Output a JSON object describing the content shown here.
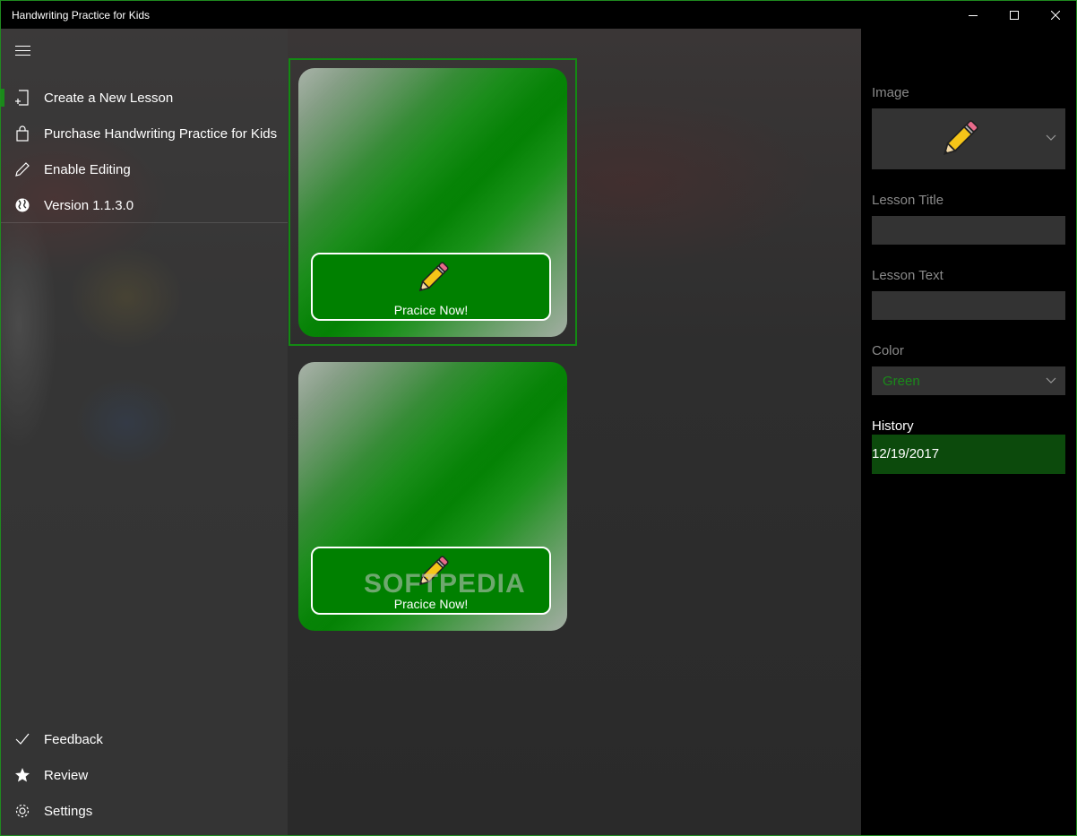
{
  "window": {
    "title": "Handwriting Practice for Kids"
  },
  "nav": {
    "items": [
      {
        "label": "Create a New Lesson",
        "icon": "new-lesson-icon"
      },
      {
        "label": "Purchase Handwriting Practice for Kids",
        "icon": "shopping-bag-icon"
      },
      {
        "label": "Enable Editing",
        "icon": "pencil-icon"
      },
      {
        "label": "Version 1.1.3.0",
        "icon": "globe-icon"
      }
    ],
    "footer": [
      {
        "label": "Feedback",
        "icon": "checkmark-icon"
      },
      {
        "label": "Review",
        "icon": "star-icon"
      },
      {
        "label": "Settings",
        "icon": "gear-icon"
      }
    ]
  },
  "tiles": [
    {
      "button_label": "Pracice Now!",
      "color": "#008000"
    },
    {
      "button_label": "Pracice Now!",
      "color": "#008000"
    }
  ],
  "watermark": "SOFTPEDIA",
  "panel": {
    "image_label": "Image",
    "lesson_title_label": "Lesson Title",
    "lesson_title_value": "",
    "lesson_text_label": "Lesson Text",
    "lesson_text_value": "",
    "color_label": "Color",
    "color_value": "Green",
    "history_label": "History",
    "history_items": [
      "12/19/2017"
    ]
  },
  "colors": {
    "accent": "#008000",
    "selection": "#138a13",
    "history_bg": "#0c4a0c"
  }
}
